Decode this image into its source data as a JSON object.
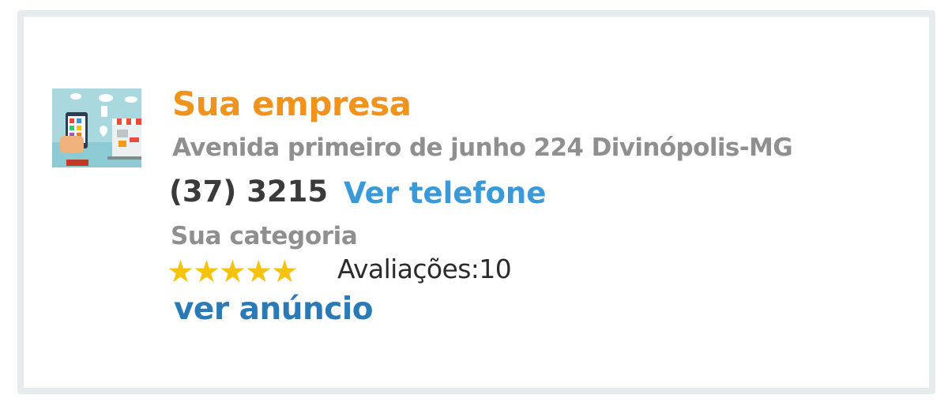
{
  "listing": {
    "image_icon": "store-phone-illustration",
    "business_name": "Sua empresa",
    "address": "Avenida primeiro de junho 224 Divinópolis-MG",
    "phone_partial": "(37) 3215",
    "show_phone_label": "Ver telefone",
    "category": "Sua categoria",
    "rating": {
      "stars": "★★★★★",
      "value": 5,
      "max": 5
    },
    "reviews_label": "Avaliações:10",
    "view_ad_label": "ver anúncio"
  },
  "colors": {
    "title": "#f0931d",
    "link_light": "#3a9ad9",
    "link_dark": "#2a7ab8",
    "muted": "#8f8f8f",
    "star": "#f5c20c",
    "border": "#e6eced"
  }
}
